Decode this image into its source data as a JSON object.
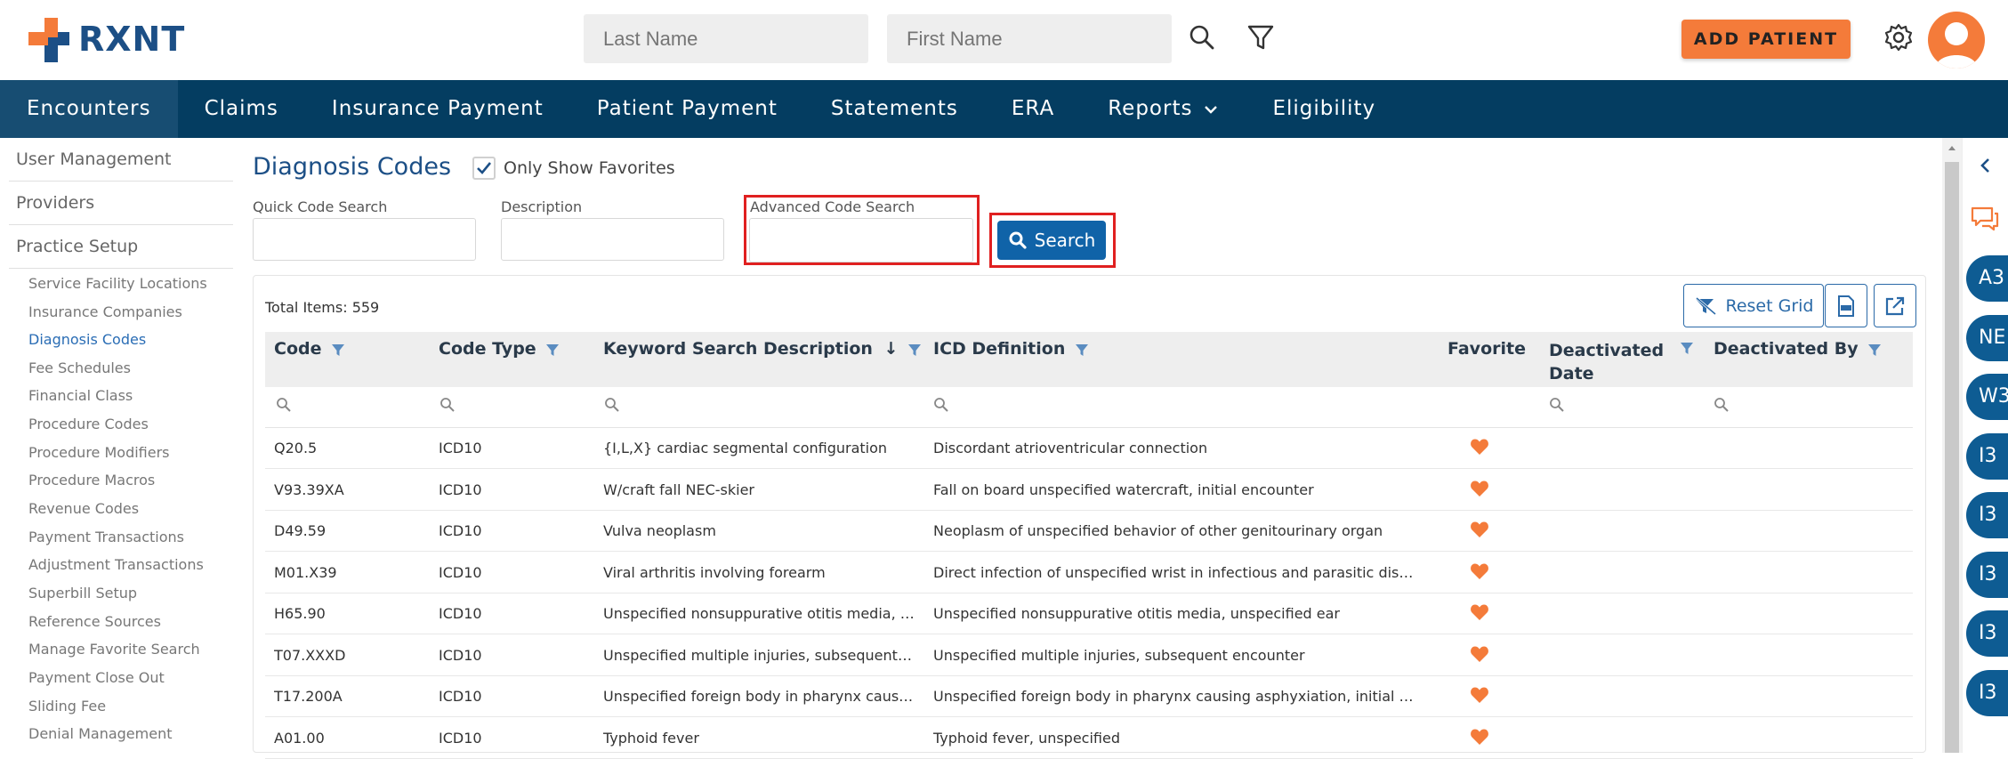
{
  "brand": {
    "name": "RXNT",
    "primary": "#1c4f86",
    "accent": "#f47b3a",
    "nav_bg": "#043d61"
  },
  "topbar": {
    "last_name_placeholder": "Last Name",
    "first_name_placeholder": "First Name",
    "add_patient_label": "ADD PATIENT"
  },
  "nav": {
    "items": [
      {
        "label": "Encounters",
        "active": true
      },
      {
        "label": "Claims"
      },
      {
        "label": "Insurance Payment"
      },
      {
        "label": "Patient Payment"
      },
      {
        "label": "Statements"
      },
      {
        "label": "ERA"
      },
      {
        "label": "Reports",
        "icon": "chevron-down-icon"
      },
      {
        "label": "Eligibility"
      }
    ]
  },
  "sidebar": {
    "headers": [
      "User Management",
      "Providers",
      "Practice Setup"
    ],
    "items": [
      "Service Facility Locations",
      "Insurance Companies",
      "Diagnosis Codes",
      "Fee Schedules",
      "Financial Class",
      "Procedure Codes",
      "Procedure Modifiers",
      "Procedure Macros",
      "Revenue Codes",
      "Payment Transactions",
      "Adjustment Transactions",
      "Superbill Setup",
      "Reference Sources",
      "Manage Favorite Search",
      "Payment Close Out",
      "Sliding Fee",
      "Denial Management"
    ],
    "active_item": "Diagnosis Codes"
  },
  "main": {
    "title": "Diagnosis Codes",
    "only_favorites_label": "Only Show Favorites",
    "only_favorites_checked": true,
    "filters": {
      "quick_code_label": "Quick Code Search",
      "description_label": "Description",
      "advanced_label": "Advanced Code Search",
      "search_button": "Search"
    },
    "grid": {
      "total_items": "Total Items: 559",
      "reset_label": "Reset Grid",
      "columns": [
        "Code",
        "Code Type",
        "Keyword Search Description",
        "ICD Definition",
        "Favorite",
        "Deactivated Date",
        "Deactivated By"
      ],
      "deactivated_date_line1": "Deactivated",
      "deactivated_date_line2": "Date",
      "sort_indicator": "↓",
      "rows": [
        {
          "code": "Q20.5",
          "type": "ICD10",
          "desc": "{I,L,X} cardiac segmental configuration",
          "icd": "Discordant atrioventricular connection"
        },
        {
          "code": "V93.39XA",
          "type": "ICD10",
          "desc": "W/craft fall NEC-skier",
          "icd": "Fall on board unspecified watercraft, initial encounter"
        },
        {
          "code": "D49.59",
          "type": "ICD10",
          "desc": "Vulva neoplasm",
          "icd": "Neoplasm of unspecified behavior of other genitourinary organ"
        },
        {
          "code": "M01.X39",
          "type": "ICD10",
          "desc": "Viral arthritis involving forearm",
          "icd": "Direct infection of unspecified wrist in infectious and parasitic disease..."
        },
        {
          "code": "H65.90",
          "type": "ICD10",
          "desc": "Unspecified nonsuppurative otitis media, uns...",
          "icd": "Unspecified nonsuppurative otitis media, unspecified ear"
        },
        {
          "code": "T07.XXXD",
          "type": "ICD10",
          "desc": "Unspecified multiple injuries, subsequent enc...",
          "icd": "Unspecified multiple injuries, subsequent encounter"
        },
        {
          "code": "T17.200A",
          "type": "ICD10",
          "desc": "Unspecified foreign body in pharynx causing ...",
          "icd": "Unspecified foreign body in pharynx causing asphyxiation, initial enco..."
        },
        {
          "code": "A01.00",
          "type": "ICD10",
          "desc": "Typhoid fever",
          "icd": "Typhoid fever, unspecified"
        }
      ]
    }
  },
  "rail": {
    "badges": [
      "A3",
      "NE",
      "W3",
      "I3",
      "I3",
      "I3",
      "I3",
      "I3"
    ]
  }
}
